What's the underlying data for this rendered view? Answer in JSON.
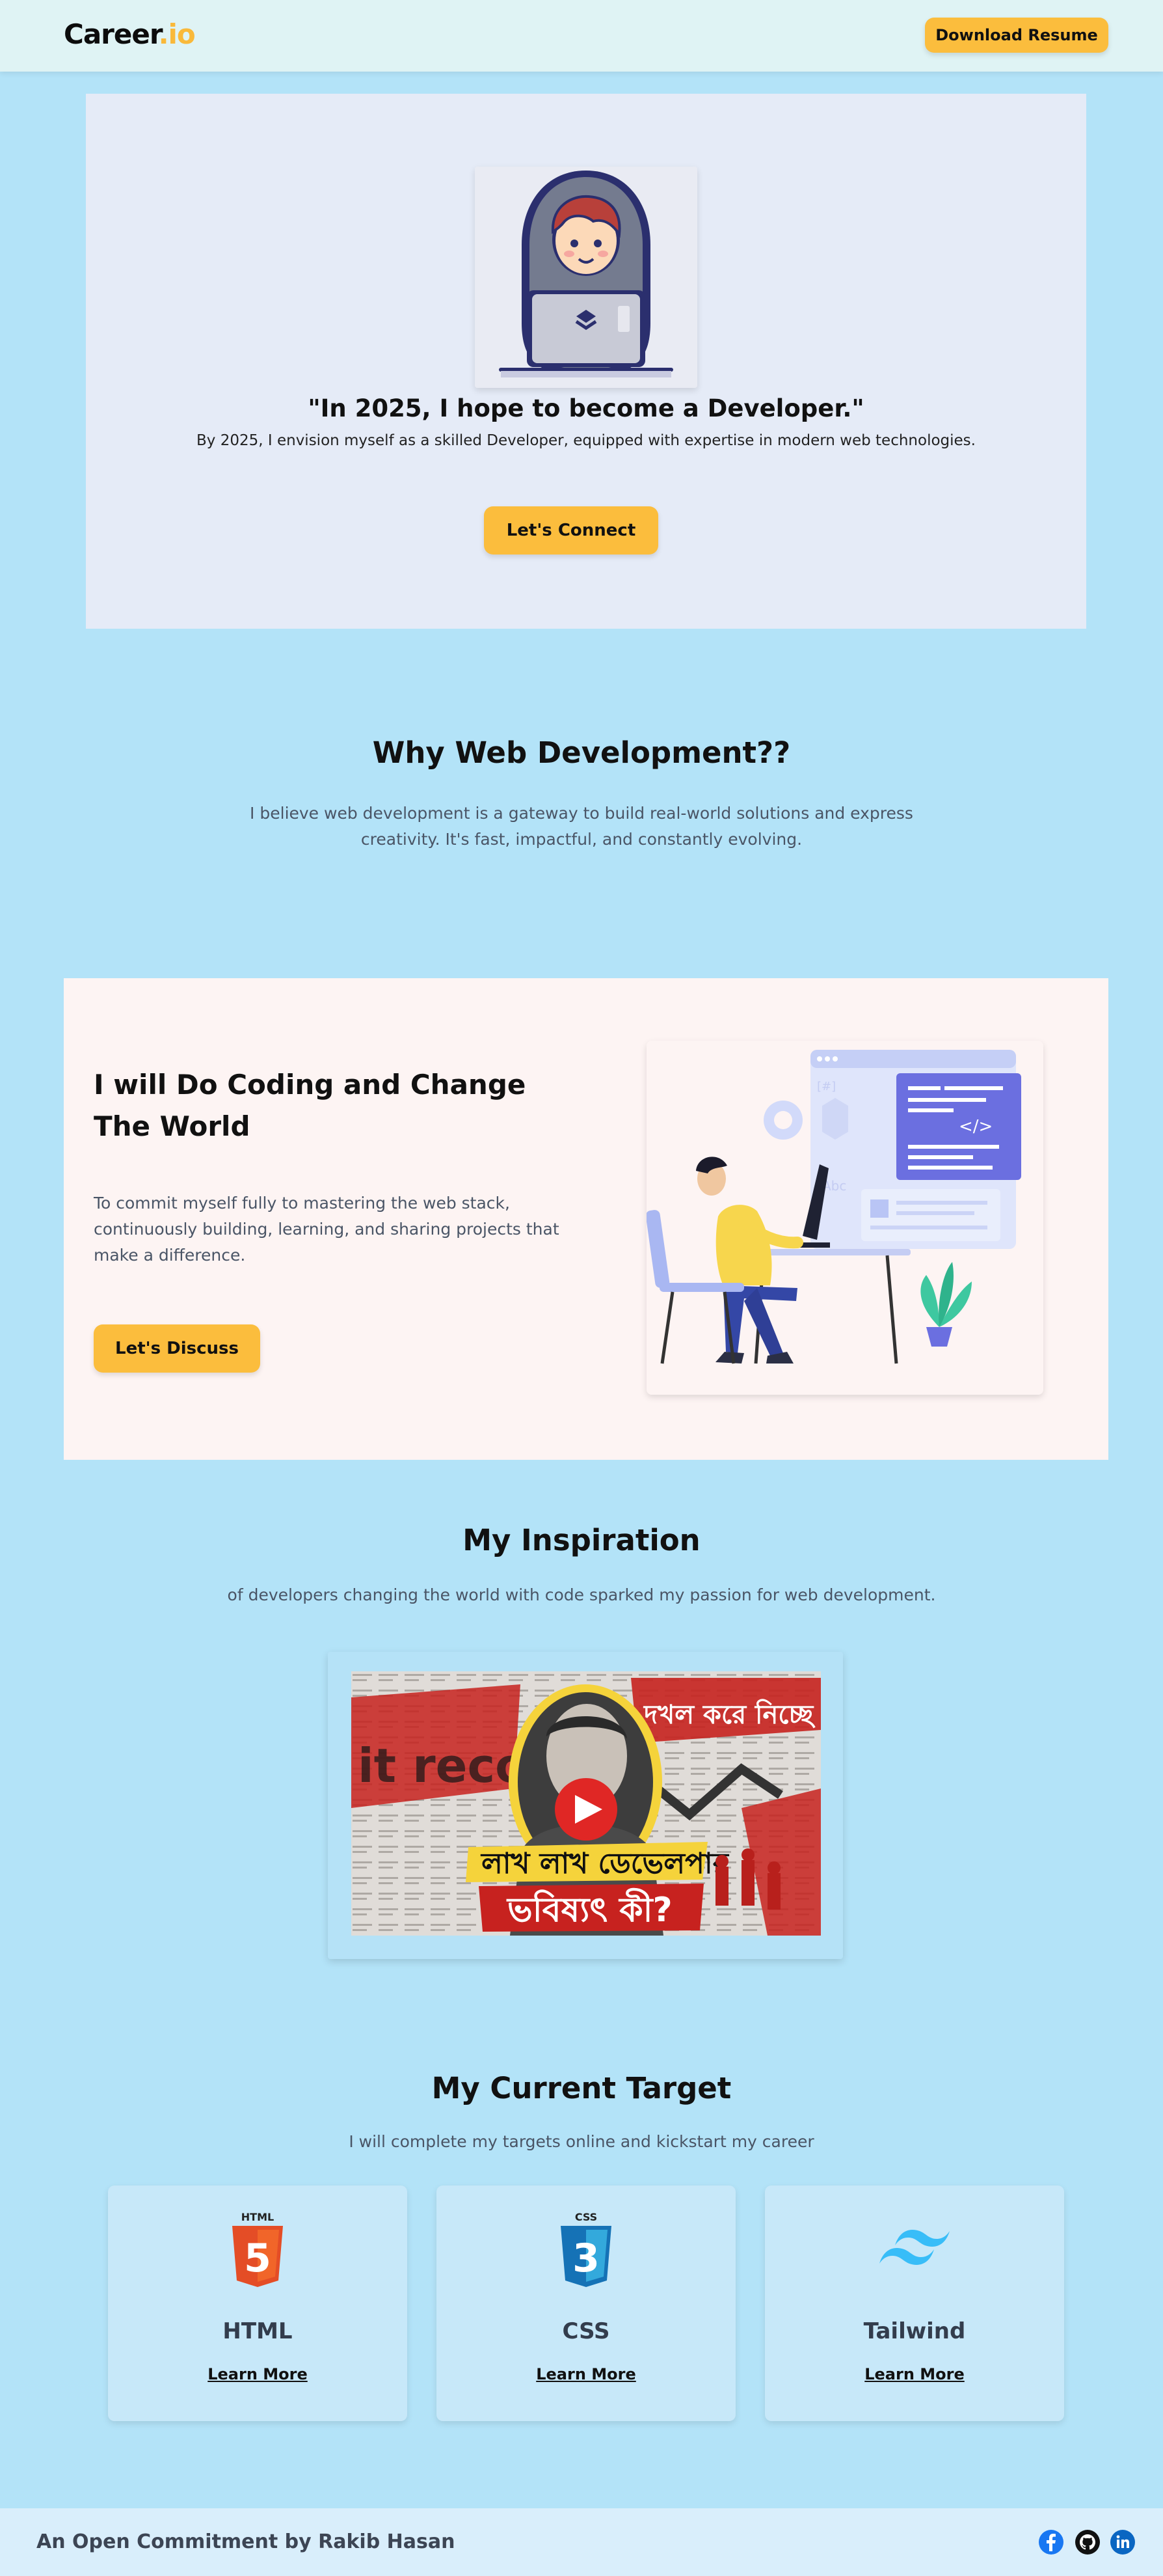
{
  "header": {
    "brand_part1": "Career",
    "brand_part2": ".io",
    "download_label": "Download Resume"
  },
  "hero": {
    "title": "\"In 2025, I hope to become a Developer.\"",
    "subtitle": "By 2025, I envision myself as a skilled Developer, equipped with expertise in modern web technologies.",
    "button_label": "Let's Connect"
  },
  "why": {
    "title": "Why Web Development??",
    "text": "I believe web development is a gateway to build real-world solutions and express creativity. It's fast, impactful, and constantly evolving."
  },
  "coding": {
    "title": "I will Do Coding and Change The World",
    "text": "To commit myself fully to mastering the web stack, continuously building, learning, and sharing projects that make a difference.",
    "button_label": "Let's Discuss"
  },
  "inspiration": {
    "title": "My Inspiration",
    "text": "of developers changing the world with code sparked my passion for web development.",
    "video_line1": "লাখ লাখ ডেভেলপার",
    "video_line2": "ভবিষ্যৎ কী?",
    "video_bg_text": "it record",
    "video_top_text": "দখল করে নিচ্ছে"
  },
  "target": {
    "title": "My Current Target",
    "text": "I will complete my targets online and kickstart my career",
    "cards": [
      {
        "badge": "HTML",
        "number": "5",
        "name": "HTML",
        "link": "Learn More",
        "color": "#e44d26"
      },
      {
        "badge": "CSS",
        "number": "3",
        "name": "CSS",
        "link": "Learn More",
        "color": "#1572b6"
      },
      {
        "badge": "",
        "number": "",
        "name": "Tailwind",
        "link": "Learn More",
        "color": "#38bdf8"
      }
    ]
  },
  "footer": {
    "text": "An Open Commitment by Rakib Hasan",
    "icons": [
      "facebook-icon",
      "github-icon",
      "linkedin-icon"
    ]
  },
  "colors": {
    "page_bg": "#b3e3f8",
    "accent": "#fbbd3d",
    "hero_bg": "#e5ebf7",
    "card_bg": "#fdf4f3"
  }
}
